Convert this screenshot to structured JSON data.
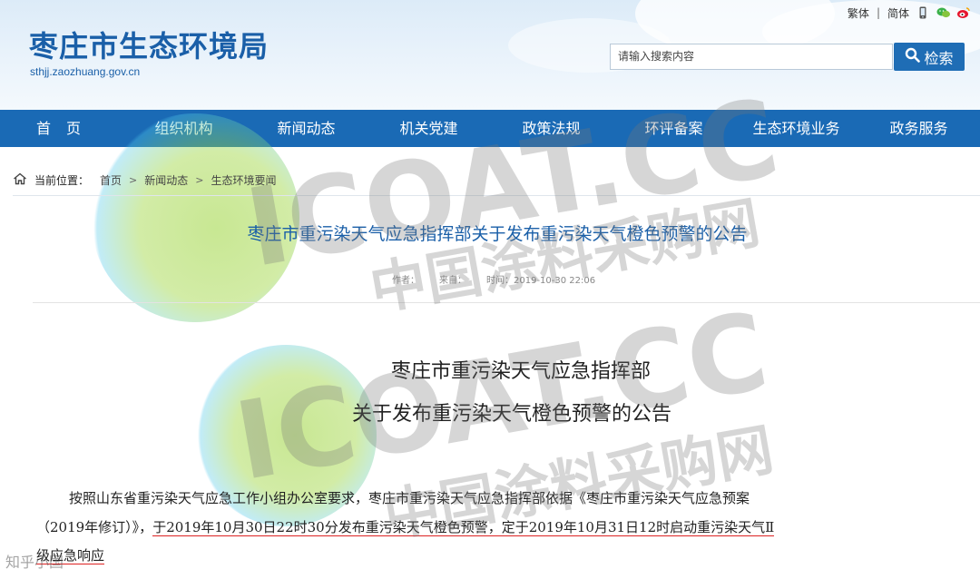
{
  "site": {
    "title": "枣庄市生态环境局",
    "domain": "sthjj.zaozhuang.gov.cn",
    "lang_traditional": "繁体",
    "lang_separator": "|",
    "lang_simplified": "简体"
  },
  "search": {
    "placeholder": "请输入搜索内容",
    "button_label": "检索"
  },
  "nav": {
    "items": [
      {
        "label": "首 页"
      },
      {
        "label": "组织机构"
      },
      {
        "label": "新闻动态"
      },
      {
        "label": "机关党建"
      },
      {
        "label": "政策法规"
      },
      {
        "label": "环评备案"
      },
      {
        "label": "生态环境业务"
      },
      {
        "label": "政务服务"
      }
    ]
  },
  "breadcrumb": {
    "label": "当前位置：",
    "items": [
      "首页",
      "新闻动态",
      "生态环境要闻"
    ],
    "arrow": ">"
  },
  "article": {
    "title": "枣庄市重污染天气应急指挥部关于发布重污染天气橙色预警的公告",
    "author_label": "作者：",
    "source_label": "来自：",
    "time_label": "时间：2019-10-30 22:06",
    "doc_title_line1": "枣庄市重污染天气应急指挥部",
    "doc_title_line2": "关于发布重污染天气橙色预警的公告",
    "para_line1": "按照山东省重污染天气应急工作小组办公室要求，枣庄市重污染天气应急指挥部依据《枣庄市重污染天气应急预案",
    "para_line2_a": "（2019年修订）》，",
    "para_line2_b": "于2019年10月30日22时30分发布重污染天气橙色预警，定于2019年10月31日12时启动重污染天气Ⅱ",
    "para_line3": "级应急响应"
  },
  "watermark": {
    "text1": "ICOAT.CC",
    "text2": "中国涂料采购网",
    "bottom_label": "知乎小国"
  },
  "colors": {
    "brand_blue": "#1a5fa8",
    "nav_blue": "#1a6ab5",
    "underline_red": "#d22222",
    "watermark_green": "#9bd43a",
    "watermark_cyan": "#4fc7e8"
  },
  "icons": {
    "mobile": "mobile-icon",
    "wechat": "wechat-icon",
    "weibo": "weibo-icon",
    "search": "search-icon",
    "home": "home-icon"
  }
}
